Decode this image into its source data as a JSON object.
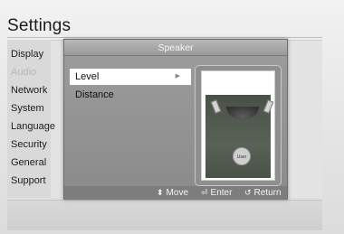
{
  "app": {
    "title": "Settings"
  },
  "menu": {
    "items": [
      {
        "label": "Display",
        "active": false
      },
      {
        "label": "Audio",
        "active": true
      },
      {
        "label": "Network",
        "active": false
      },
      {
        "label": "System",
        "active": false
      },
      {
        "label": "Language",
        "active": false
      },
      {
        "label": "Security",
        "active": false
      },
      {
        "label": "General",
        "active": false
      },
      {
        "label": "Support",
        "active": false
      }
    ]
  },
  "dialog": {
    "title": "Speaker",
    "options": [
      {
        "label": "Level",
        "selected": true,
        "arrow": "▶"
      },
      {
        "label": "Distance",
        "selected": false
      }
    ],
    "preview": {
      "user_label": "User",
      "icon": "room-speaker-layout"
    },
    "footer": {
      "move": {
        "icon": "⬍",
        "label": "Move"
      },
      "enter": {
        "icon": "⏎",
        "label": "Enter"
      },
      "return": {
        "icon": "↺",
        "label": "Return"
      }
    }
  },
  "colors": {
    "selected_bg": "#ffffff",
    "dialog_bg": "#8a8a8a",
    "active_menu_text": "#b8b8b8"
  }
}
